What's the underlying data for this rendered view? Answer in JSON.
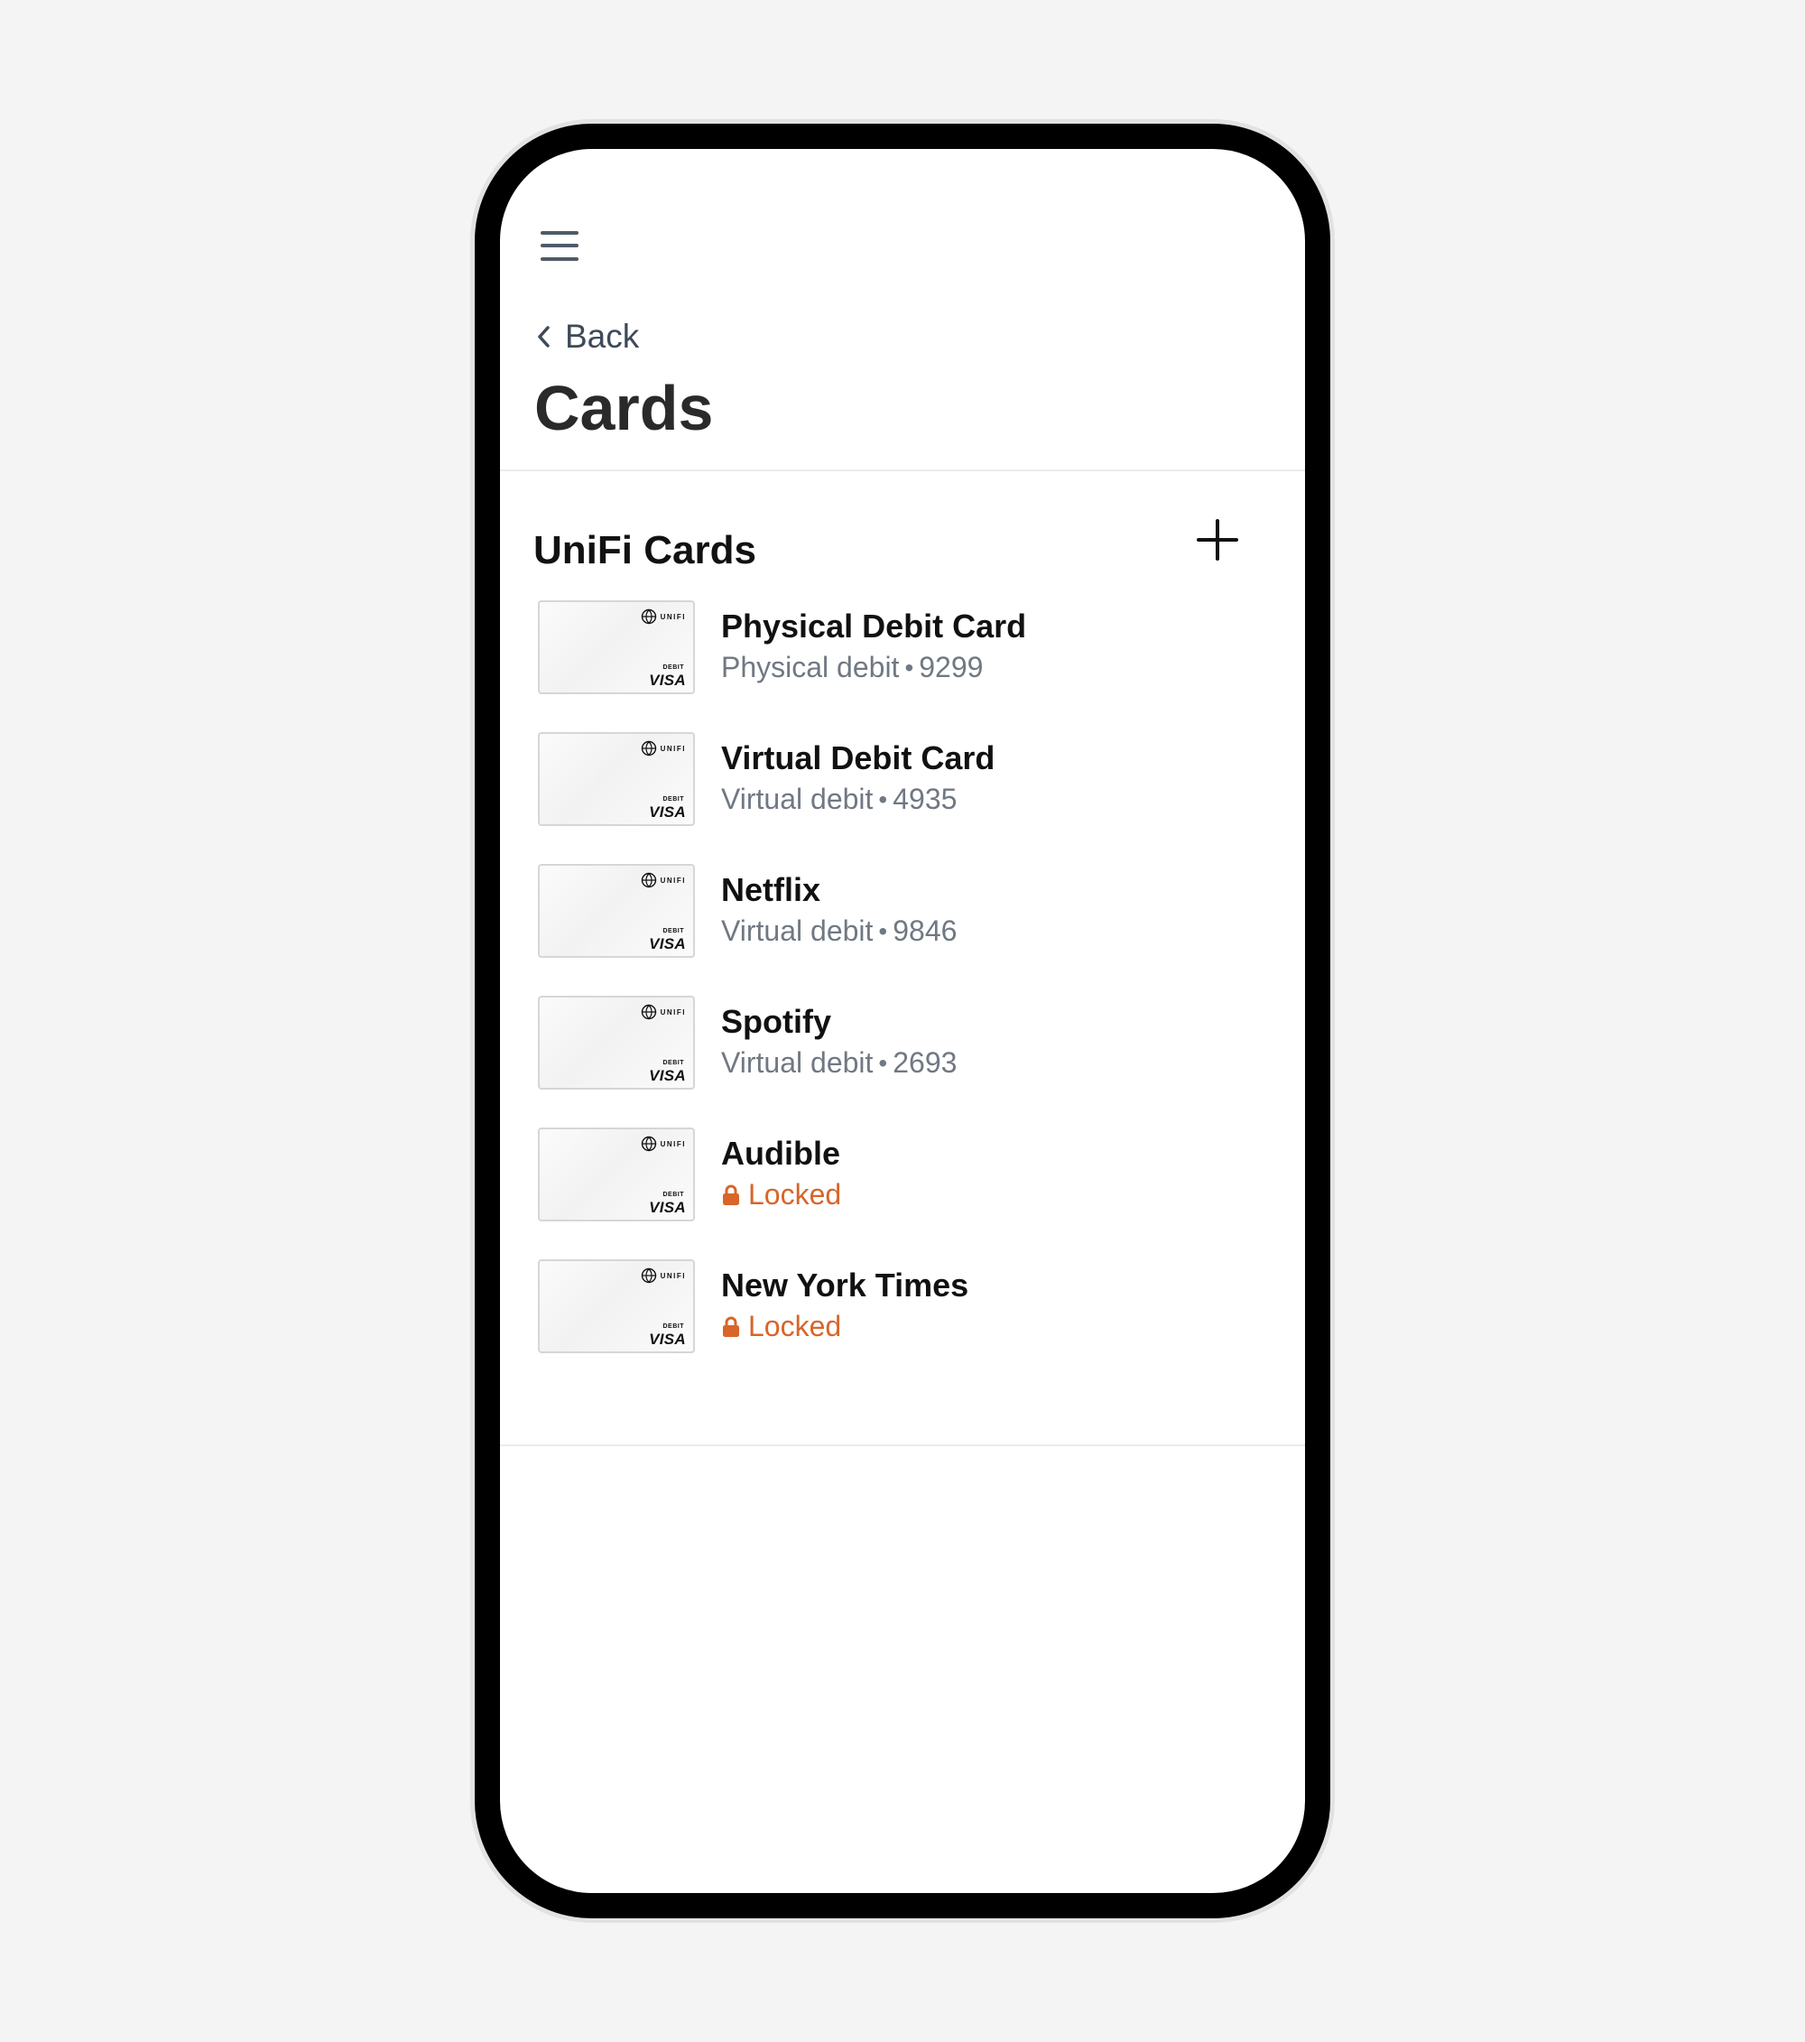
{
  "header": {
    "menu_icon": "hamburger-menu-icon",
    "back_label": "Back",
    "back_icon": "chevron-left-icon",
    "title": "Cards"
  },
  "section": {
    "title": "UniFi Cards",
    "add_icon": "plus-icon"
  },
  "thumbnail": {
    "brand": "UNIFI",
    "type": "DEBIT",
    "network": "VISA"
  },
  "cards": [
    {
      "name": "Physical Debit Card",
      "kind": "Physical debit",
      "last4": "9299",
      "locked": false
    },
    {
      "name": "Virtual Debit Card",
      "kind": "Virtual debit",
      "last4": "4935",
      "locked": false
    },
    {
      "name": "Netflix",
      "kind": "Virtual debit",
      "last4": "9846",
      "locked": false
    },
    {
      "name": "Spotify",
      "kind": "Virtual debit",
      "last4": "2693",
      "locked": false
    },
    {
      "name": "Audible",
      "status": "Locked",
      "locked": true
    },
    {
      "name": "New York Times",
      "status": "Locked",
      "locked": true
    }
  ],
  "colors": {
    "locked": "#d8652a",
    "muted_text": "#707883",
    "phone_frame": "#000000",
    "background": "#f4f4f4"
  }
}
